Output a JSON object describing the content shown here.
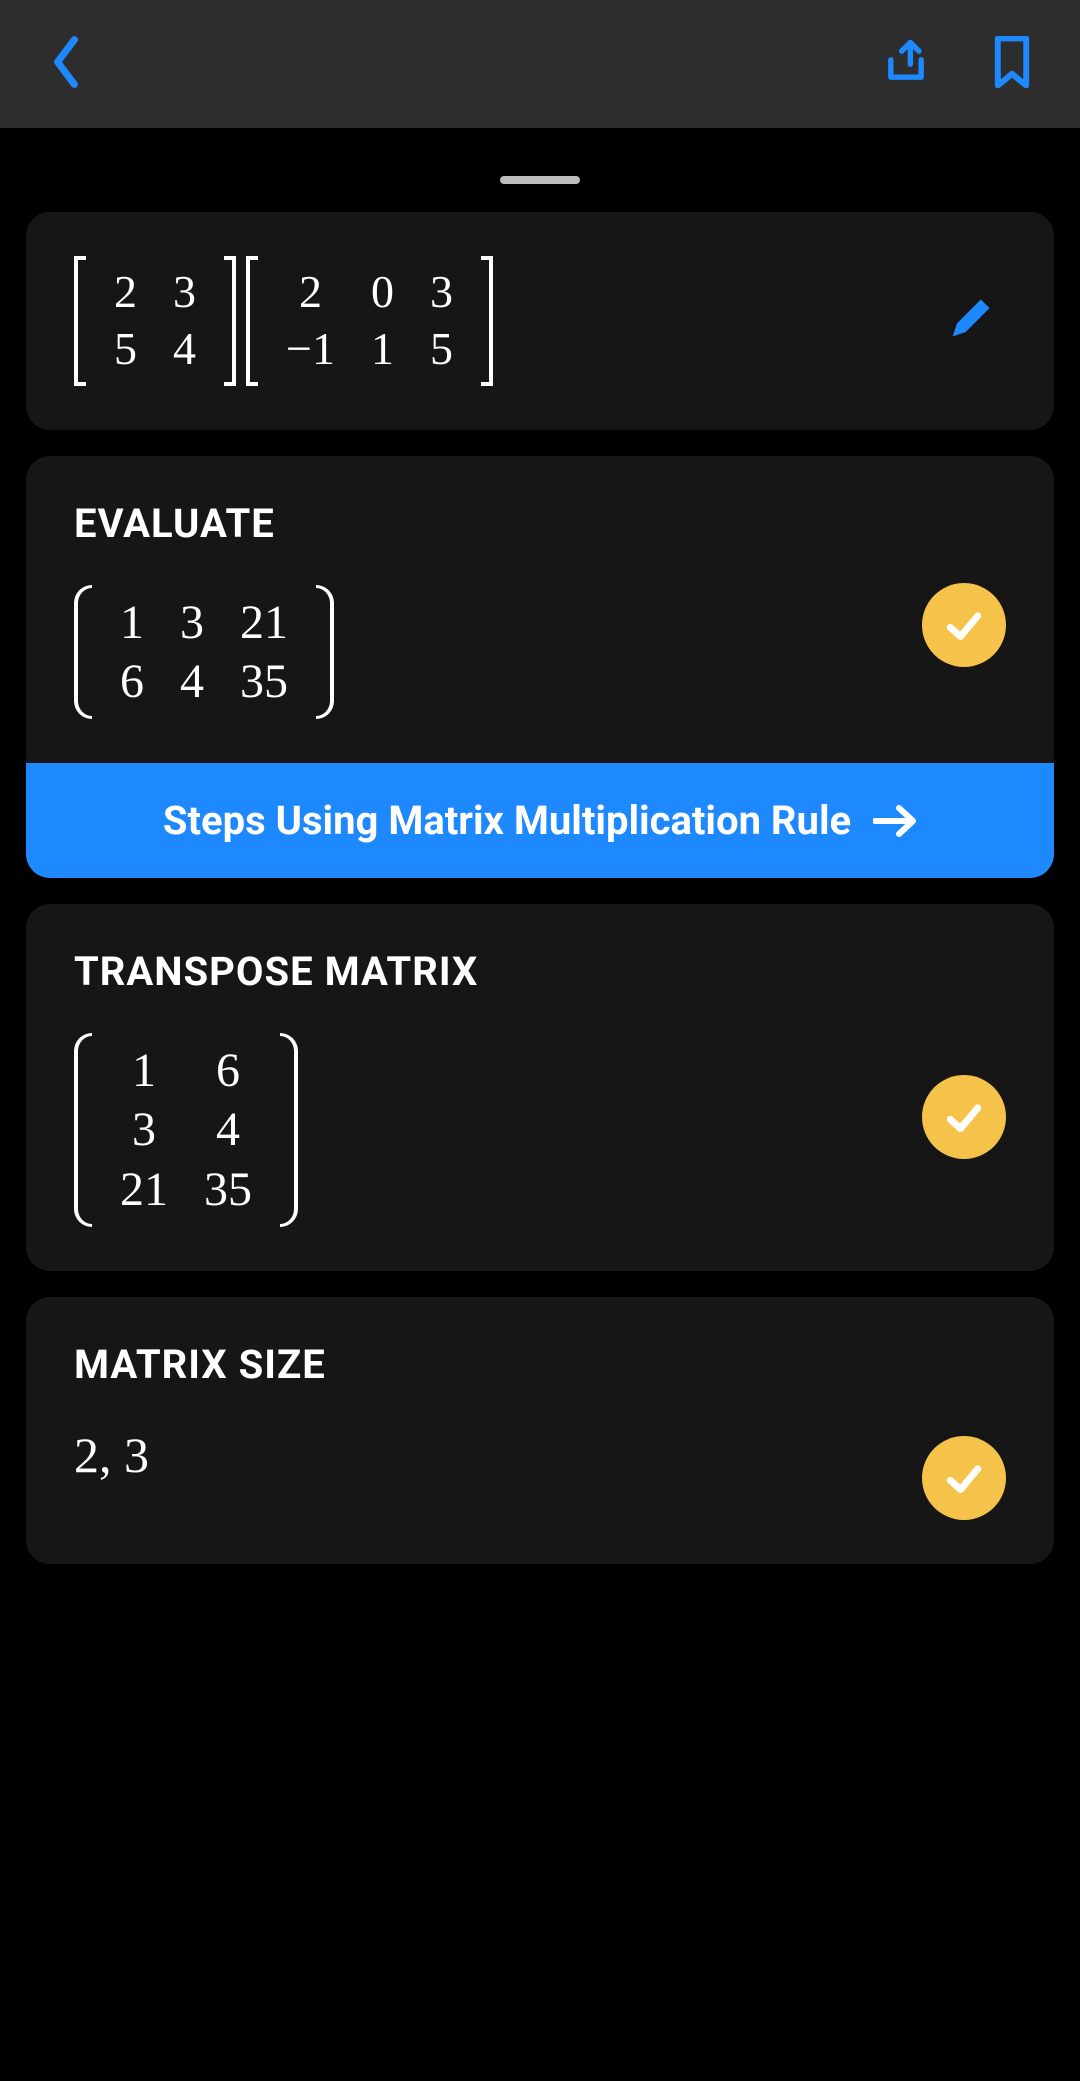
{
  "colors": {
    "accent": "#1e88ff",
    "check": "#f6c34a"
  },
  "input": {
    "matrices": [
      {
        "bracket": "square",
        "rows": [
          [
            "2",
            "3"
          ],
          [
            "5",
            "4"
          ]
        ]
      },
      {
        "bracket": "square",
        "rows": [
          [
            "2",
            "0",
            "3"
          ],
          [
            "−1",
            "1",
            "5"
          ]
        ]
      }
    ]
  },
  "sections": {
    "evaluate": {
      "title": "EVALUATE",
      "matrix": {
        "bracket": "round",
        "rows": [
          [
            "1",
            "3",
            "21"
          ],
          [
            "6",
            "4",
            "35"
          ]
        ]
      },
      "steps_label": "Steps Using Matrix Multiplication Rule"
    },
    "transpose": {
      "title": "TRANSPOSE MATRIX",
      "matrix": {
        "bracket": "round",
        "rows": [
          [
            "1",
            "6"
          ],
          [
            "3",
            "4"
          ],
          [
            "21",
            "35"
          ]
        ]
      }
    },
    "size": {
      "title": "MATRIX SIZE",
      "value": "2, 3"
    }
  }
}
